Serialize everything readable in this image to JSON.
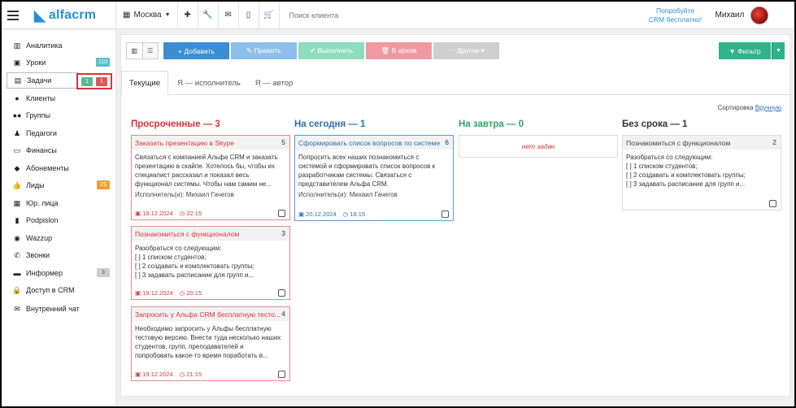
{
  "topbar": {
    "logo_text": "alfacrm",
    "city": "Москва",
    "search_placeholder": "Поиск клиента",
    "promo_line1": "Попробуйте",
    "promo_line2": "CRM бесплатно!",
    "user_name": "Михаил"
  },
  "sidebar": {
    "items": [
      {
        "label": "Аналитика",
        "icon": "chart-icon"
      },
      {
        "label": "Уроки",
        "icon": "calendar-icon",
        "badge": "110"
      },
      {
        "label": "Задачи",
        "icon": "clipboard-icon"
      },
      {
        "label": "Клиенты",
        "icon": "user-icon"
      },
      {
        "label": "Группы",
        "icon": "users-icon"
      },
      {
        "label": "Педагоги",
        "icon": "teacher-icon"
      },
      {
        "label": "Финансы",
        "icon": "money-icon"
      },
      {
        "label": "Абонементы",
        "icon": "tag-icon"
      },
      {
        "label": "Лиды",
        "icon": "thumbs-up-icon",
        "badge": "21"
      },
      {
        "label": "Юр. лица",
        "icon": "building-icon"
      },
      {
        "label": "Podpislon",
        "icon": "file-icon"
      },
      {
        "label": "Wazzup",
        "icon": "whatsapp-icon"
      },
      {
        "label": "Звонки",
        "icon": "phone-icon"
      },
      {
        "label": "Информер",
        "icon": "monitor-icon",
        "badge": "3"
      },
      {
        "label": "Доступ в CRM",
        "icon": "lock-icon"
      },
      {
        "label": "Внутренний чат",
        "icon": "envelope-icon"
      }
    ],
    "tasks_badge_green": "1",
    "tasks_badge_red": "1",
    "colors": {
      "teal": "#5bc0c8",
      "orange": "#f0a030",
      "gray": "#c9d0d0",
      "green": "#5cb88a",
      "red": "#e0555a"
    }
  },
  "toolbar": {
    "add": "+ Добавить",
    "edit": "✎ Править",
    "done": "✔ Выполнить",
    "archive": "🗑 В архив",
    "other": "··· Другое ▾",
    "filter": "▼ Фильтр"
  },
  "tabs": [
    "Текущие",
    "Я — исполнитель",
    "Я — автор"
  ],
  "sort": {
    "label": "Сортировка",
    "value": "Вручную"
  },
  "columns": {
    "overdue": {
      "title": "Просроченные — 3",
      "color": "#d9333a"
    },
    "today": {
      "title": "На сегодня — 1",
      "color": "#2b6fb3"
    },
    "tomorrow": {
      "title": "На завтра — 0",
      "color": "#2fa36b",
      "empty": "нет задач"
    },
    "nodate": {
      "title": "Без срока — 1",
      "color": "#333333"
    }
  },
  "cards": {
    "c1": {
      "title": "Заказать презентацию в Skype",
      "num": "5",
      "body": [
        "Связаться с компанией Альфа CRM и заказать",
        "презентацию в скайпе. Хотелось бы, чтобы их",
        "специалист рассказал и показал весь",
        "функционал системы. Чтобы нам самим не..."
      ],
      "exec": "Исполнитель(и): Михаил Гачегов",
      "date": "19.12.2024",
      "time": "22:15"
    },
    "c2": {
      "title": "Познакомиться с функционалом",
      "num": "3",
      "body": [
        "Разобраться со следующим:",
        "[ ] 1 списком студентов;",
        "[ ] 2 создавать и комплектовать группы;",
        "[ ] 3 задавать расписание для групп и..."
      ],
      "date": "19.12.2024",
      "time": "20:15"
    },
    "c3": {
      "title": "Запросить у Альфа CRM бесплатную тесто...",
      "num": "4",
      "body": [
        "Необходимо запросить у Альфы бесплатную",
        "тестовую версию. Внести туда несколько наших",
        "студентов, групп, преподавателей и",
        "попробовать какое-то время поработать в..."
      ],
      "date": "19.12.2024",
      "time": "21:15"
    },
    "c4": {
      "title": "Сформировать список вопросов по системе",
      "num": "6",
      "body": [
        "Попросить всех наших познакомиться с",
        "системой и сформировать список вопросов к",
        "разработчикам системы. Связаться с",
        "представителем Альфа CRM."
      ],
      "exec": "Исполнитель(и): Михаил Гачегов",
      "date": "20.12.2024",
      "time": "18:15"
    },
    "c5": {
      "title": "Познакомиться с функционалом",
      "num": "2",
      "body": [
        "Разобраться со следующим:",
        "[ ] 1 списком студентов;",
        "[ ] 2 создавать и комплектовать группы;",
        "[ ] 3 задавать расписание для групп и..."
      ]
    }
  }
}
